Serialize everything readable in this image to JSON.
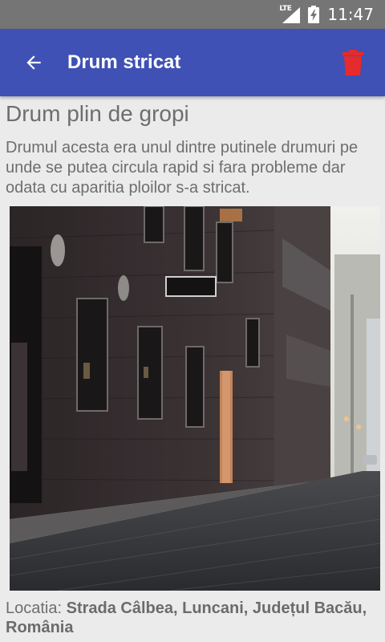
{
  "status_bar": {
    "network": "LTE",
    "time": "11:47"
  },
  "app_bar": {
    "title": "Drum stricat",
    "back_icon": "arrow-back-icon",
    "delete_icon": "trash-icon",
    "color": "#3f51b5",
    "delete_color": "#e52b2b"
  },
  "post": {
    "title": "Drum plin de gropi",
    "description": "Drumul acesta era unul dintre putinele drumuri pe unde se putea circula rapid si fara probleme dar odata cu aparitia ploilor s-a stricat.",
    "location_label": "Locatia:",
    "location_value": "Strada Câlbea, Luncani, Județul Bacău, România"
  }
}
